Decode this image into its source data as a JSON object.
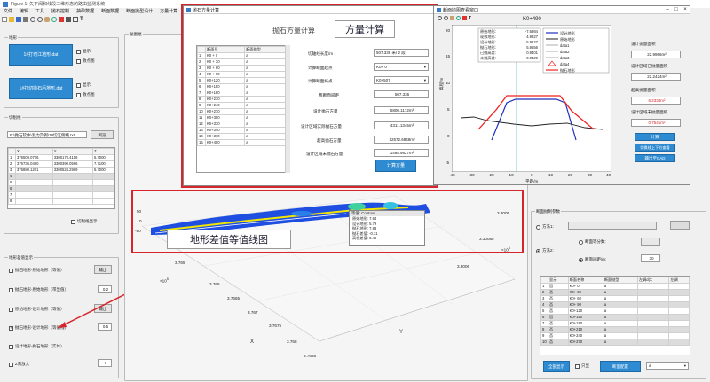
{
  "main": {
    "title": "Figure 1: 矢下阀和线段三维形态的路由监测系统",
    "menu": [
      "文件",
      "编辑",
      "工具",
      "抛石控制",
      "抽砂数据",
      "断面数据",
      "断面抛型设计",
      "方量计算",
      "断"
    ],
    "toolbar_icons": [
      "new-icon",
      "open-icon",
      "save-icon",
      "print-icon",
      "zoom-in-icon",
      "zoom-out-icon",
      "pan-icon",
      "rotate-icon",
      "datacursor-icon",
      "brush-icon",
      "insert-icon",
      "text-icon"
    ]
  },
  "left": {
    "terrain_group": "地形",
    "btn_load1": "1#打切江地形.dat",
    "btn_load2": "1#打切抛石后地形.dat",
    "show1": "显示",
    "pts1": "散点图",
    "show2": "显示",
    "pts2": "散点图",
    "section_group": "切削线",
    "path_value": "E:\\抛石软件\\测力实例\\1#切江侧线.txt",
    "browse": "浏览",
    "table_headers": [
      "",
      "X",
      "Y",
      "Z"
    ],
    "table_rows": [
      [
        "1",
        "376509.0726",
        "3300178.4156",
        "5.7000"
      ],
      [
        "2",
        "376736.0490",
        "3300390.0566",
        "7.7100"
      ],
      [
        "3",
        "376880.1201",
        "3300524.2969",
        "5.7000"
      ],
      [
        "4",
        "",
        "",
        ""
      ],
      [
        "5",
        "",
        "",
        ""
      ],
      [
        "6",
        "",
        "",
        ""
      ],
      [
        "7",
        "",
        "",
        ""
      ],
      [
        "8",
        "",
        "",
        ""
      ]
    ],
    "cut_show": "切削线显示",
    "diff_group": "地形差值显示",
    "opt1": "抛石地形-原始地形（等值）",
    "opt2": "抛石地形-原始地形（带显值）",
    "opt3": "原始地形-设计地形（等值）",
    "opt4": "抛石地形-设计地形（等值线）",
    "opt5": "设计地形-抛石地形（实体）",
    "zscale": "Z向放大",
    "btn_output1": "输出",
    "btn_output2": "输出",
    "val1": "0.2",
    "val2": "0.5",
    "val3": "1"
  },
  "plot3d": {
    "group": "总图幅",
    "ytick_left": [
      "50",
      "0",
      "-50"
    ],
    "xticks": [
      "3.767",
      "3.7675",
      "3.768",
      "3.7685"
    ],
    "yticks": [
      "3.3005",
      "3.30055",
      "3.3006"
    ],
    "x_exp": "×10",
    "y_exp": "×10",
    "exp_sup": "5",
    "exp_sup_y": "6",
    "xlabel": "X",
    "ylabel": "Y",
    "left_ticks": [
      "3.765",
      "3.766",
      "3.7665"
    ],
    "tooltip_title": "等值: Contour",
    "tooltip_lines": [
      "原始地形: 7.64",
      "设计地形: 5.79",
      "抛石地形: 7.83",
      "抛石差值: -0.31",
      "高程差值: 0.46"
    ]
  },
  "calc_window": {
    "title": "抛石方量计算",
    "heading": "抛石方量计算",
    "annot": "方量计算",
    "headers": [
      "",
      "断面号",
      "断面抛型"
    ],
    "rows": [
      [
        "1",
        "K0 + 0",
        "a"
      ],
      [
        "2",
        "K0 + 30",
        "a"
      ],
      [
        "3",
        "K0 + 60",
        "a"
      ],
      [
        "4",
        "K0 + 90",
        "a"
      ],
      [
        "5",
        "K0+120",
        "a"
      ],
      [
        "6",
        "K0+150",
        "a"
      ],
      [
        "7",
        "K0+180",
        "a"
      ],
      [
        "8",
        "K0+210",
        "a"
      ],
      [
        "9",
        "K0+240",
        "a"
      ],
      [
        "10",
        "K0+270",
        "a"
      ],
      [
        "11",
        "K0+300",
        "a"
      ],
      [
        "12",
        "K0+310",
        "a"
      ],
      [
        "13",
        "K0+340",
        "a"
      ],
      [
        "14",
        "K0+370",
        "a"
      ],
      [
        "15",
        "K0+400",
        "a"
      ]
    ],
    "f1_label": "切轴线长度/m",
    "f1_value": "507.336 米/ 2 段",
    "f2_label": "计算断面起点",
    "f2_value": "K0+ 0",
    "f3_label": "计算断面终点",
    "f3_value": "K0+507",
    "f4_label": "两断面间距",
    "f4_value": "507.336",
    "f5_label": "设计抛石方量",
    "f5_value": "5800.1172m³",
    "f6_label": "设计区域实际抛石方量",
    "f6_value": "4311.1345m³",
    "f7_label": "超高抛石方量",
    "f7_value": "32572.6848m³",
    "f8_label": "设计区域未抛石方量",
    "f8_value": "1488.9827m³",
    "calc_btn": "计算方量"
  },
  "section_window": {
    "title": "断面抛图查看窗口",
    "plot_title": "K0+490",
    "ylabel": "高程/m",
    "xlabel": "平距/m",
    "yticks": [
      "20",
      "15",
      "10",
      "5",
      "0",
      "-5"
    ],
    "xticks": [
      "-40",
      "-30",
      "-20",
      "-10",
      "0",
      "10",
      "20",
      "30",
      "40"
    ],
    "info": [
      [
        "原始地形:",
        "-7.6984"
      ],
      [
        "现数地形:",
        "4.9827"
      ],
      [
        "设计地形:",
        "5.9227"
      ],
      [
        "抛石地形:",
        "5.9556"
      ],
      [
        "已抛高差:",
        "0.9401"
      ],
      [
        "未抛高差:",
        "0.0329"
      ]
    ],
    "legend": [
      "设计地形",
      "原始地形",
      "data1",
      "data2",
      "data3",
      "data4",
      "抛石地形"
    ],
    "r1_label": "设计抛量面积",
    "r1_value": "22.9966m²",
    "r2_label": "设计区域已抛量面积",
    "r2_value": "22.2424m²",
    "r3_label": "超高抛量面积",
    "r3_value": "6.2334m²",
    "r4_label": "设计区域未抛量面积",
    "r4_value": "0.7541m²",
    "btn1": "计算",
    "btn2": "切换线上下方查看",
    "btn3": "输出至CAD"
  },
  "right": {
    "group": "断面抛制参数",
    "method1": "方法1:",
    "method2": "方法2:",
    "eq_label": "断面等分数:",
    "dist_label": "断面间距/m:",
    "dist_value": "30",
    "table_headers": [
      "显示",
      "断面名称",
      "断面抛型",
      "左调d(X",
      "左调"
    ],
    "rows": [
      [
        "1",
        "否",
        "K0+ 0",
        "a"
      ],
      [
        "2",
        "否",
        "K0+ 30",
        "a"
      ],
      [
        "3",
        "否",
        "K0+ 60",
        "a"
      ],
      [
        "4",
        "否",
        "K0+ 90",
        "a"
      ],
      [
        "5",
        "否",
        "K0+120",
        "a"
      ],
      [
        "6",
        "否",
        "K0+150",
        "a"
      ],
      [
        "7",
        "否",
        "K0+180",
        "a"
      ],
      [
        "8",
        "否",
        "K0+210",
        "a"
      ],
      [
        "9",
        "否",
        "K0+240",
        "a"
      ],
      [
        "10",
        "否",
        "K0+270",
        "a"
      ]
    ],
    "btn_all": "全部显示",
    "only": "只显",
    "btn_config": "断面配置",
    "sel": "a"
  },
  "annotation_contour": "地形差值等值线图"
}
